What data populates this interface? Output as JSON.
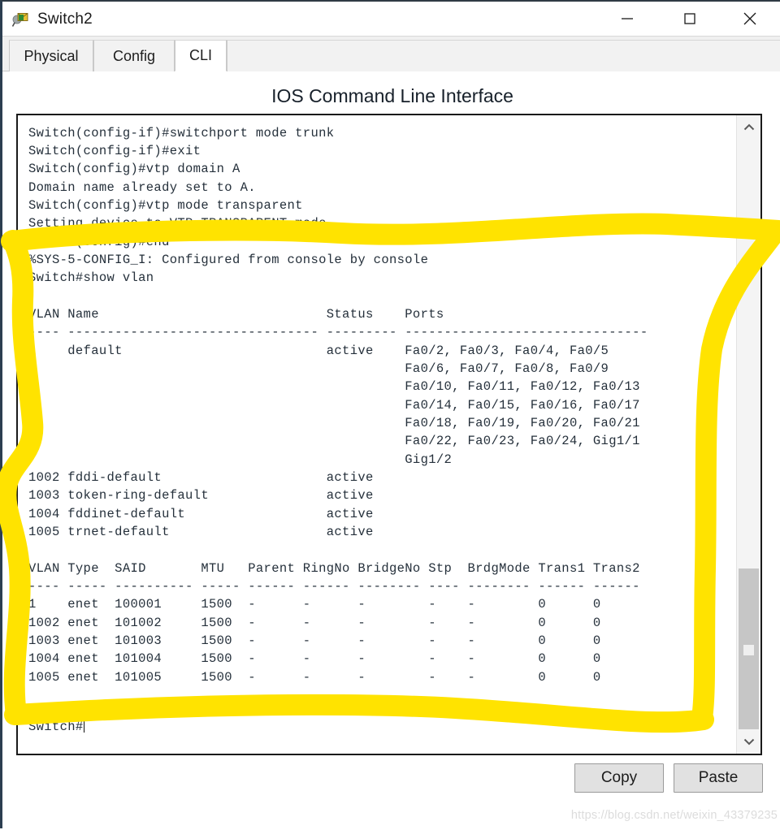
{
  "window": {
    "title": "Switch2",
    "icon": "switch-device-icon",
    "controls": {
      "minimize": "minimize-icon",
      "maximize": "maximize-icon",
      "close": "close-icon"
    }
  },
  "tabs": [
    {
      "label": "Physical",
      "active": false
    },
    {
      "label": "Config",
      "active": false
    },
    {
      "label": "CLI",
      "active": true
    }
  ],
  "panel": {
    "title": "IOS Command Line Interface"
  },
  "terminal": {
    "lines": [
      "Switch(config-if)#switchport mode trunk",
      "Switch(config-if)#exit",
      "Switch(config)#vtp domain A",
      "Domain name already set to A.",
      "Switch(config)#vtp mode transparent",
      "Setting device to VTP TRANSPARENT mode.",
      "Switch(config)#end",
      "%SYS-5-CONFIG_I: Configured from console by console",
      "Switch#show vlan",
      "",
      "VLAN Name                             Status    Ports",
      "---- -------------------------------- --------- -------------------------------",
      "1    default                          active    Fa0/2, Fa0/3, Fa0/4, Fa0/5",
      "                                                Fa0/6, Fa0/7, Fa0/8, Fa0/9",
      "                                                Fa0/10, Fa0/11, Fa0/12, Fa0/13",
      "                                                Fa0/14, Fa0/15, Fa0/16, Fa0/17",
      "                                                Fa0/18, Fa0/19, Fa0/20, Fa0/21",
      "                                                Fa0/22, Fa0/23, Fa0/24, Gig1/1",
      "                                                Gig1/2",
      "1002 fddi-default                     active    ",
      "1003 token-ring-default               active    ",
      "1004 fddinet-default                  active    ",
      "1005 trnet-default                    active    ",
      "",
      "VLAN Type  SAID       MTU   Parent RingNo BridgeNo Stp  BrdgMode Trans1 Trans2",
      "---- ----- ---------- ----- ------ ------ -------- ---- -------- ------ ------",
      "1    enet  100001     1500  -      -      -        -    -        0      0",
      "1002 enet  101002     1500  -      -      -        -    -        0      0",
      "1003 enet  101003     1500  -      -      -        -    -        0      0",
      "1004 enet  101004     1500  -      -      -        -    -        0      0",
      "1005 enet  101005     1500  -      -      -        -    -        0      0",
      ""
    ],
    "prompt_lines": "Switch#\nSwitch#",
    "vlan_table": {
      "type": "table",
      "columns": [
        "VLAN",
        "Name",
        "Status",
        "Ports"
      ],
      "rows": [
        {
          "vlan": "1",
          "name": "default",
          "status": "active",
          "ports": "Fa0/2, Fa0/3, Fa0/4, Fa0/5, Fa0/6, Fa0/7, Fa0/8, Fa0/9, Fa0/10, Fa0/11, Fa0/12, Fa0/13, Fa0/14, Fa0/15, Fa0/16, Fa0/17, Fa0/18, Fa0/19, Fa0/20, Fa0/21, Fa0/22, Fa0/23, Fa0/24, Gig1/1, Gig1/2"
        },
        {
          "vlan": "1002",
          "name": "fddi-default",
          "status": "active",
          "ports": ""
        },
        {
          "vlan": "1003",
          "name": "token-ring-default",
          "status": "active",
          "ports": ""
        },
        {
          "vlan": "1004",
          "name": "fddinet-default",
          "status": "active",
          "ports": ""
        },
        {
          "vlan": "1005",
          "name": "trnet-default",
          "status": "active",
          "ports": ""
        }
      ]
    },
    "vlan_detail_table": {
      "type": "table",
      "columns": [
        "VLAN",
        "Type",
        "SAID",
        "MTU",
        "Parent",
        "RingNo",
        "BridgeNo",
        "Stp",
        "BrdgMode",
        "Trans1",
        "Trans2"
      ],
      "rows": [
        [
          "1",
          "enet",
          "100001",
          "1500",
          "-",
          "-",
          "-",
          "-",
          "-",
          "0",
          "0"
        ],
        [
          "1002",
          "enet",
          "101002",
          "1500",
          "-",
          "-",
          "-",
          "-",
          "-",
          "0",
          "0"
        ],
        [
          "1003",
          "enet",
          "101003",
          "1500",
          "-",
          "-",
          "-",
          "-",
          "-",
          "0",
          "0"
        ],
        [
          "1004",
          "enet",
          "101004",
          "1500",
          "-",
          "-",
          "-",
          "-",
          "-",
          "0",
          "0"
        ],
        [
          "1005",
          "enet",
          "101005",
          "1500",
          "-",
          "-",
          "-",
          "-",
          "-",
          "0",
          "0"
        ]
      ]
    }
  },
  "scrollbar": {
    "up_icon": "chevron-up-icon",
    "down_icon": "chevron-down-icon"
  },
  "buttons": {
    "copy": "Copy",
    "paste": "Paste"
  },
  "watermark": "https://blog.csdn.net/weixin_43379235",
  "annotation": {
    "color": "#FFE300",
    "shape": "hand-drawn-rectangle-highlight"
  },
  "colors": {
    "accent": "#FFE300",
    "terminal_text": "#25303b",
    "window_chrome": "#f0f0f0"
  }
}
